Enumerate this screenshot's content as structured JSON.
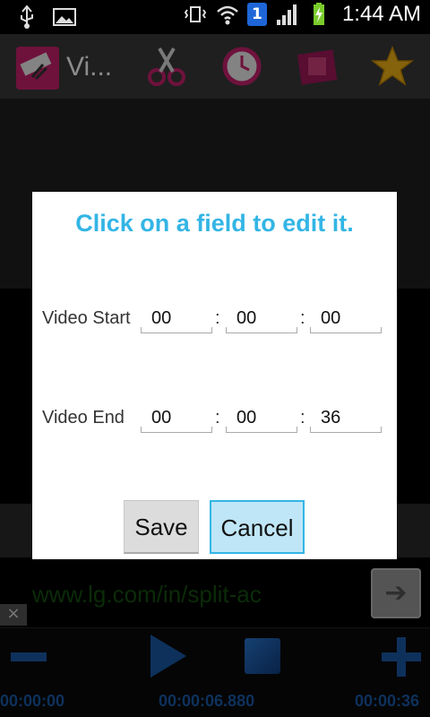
{
  "status_bar": {
    "time": "1:44 AM",
    "sim_badge": "1",
    "icons": [
      "usb-icon",
      "image-icon",
      "vibrate-icon",
      "wifi-icon",
      "sim-badge-icon",
      "signal-icon",
      "battery-charging-icon"
    ]
  },
  "action_bar": {
    "app_title": "Vi...",
    "icons": [
      "scissors-icon",
      "clock-icon",
      "film-icon",
      "star-icon"
    ]
  },
  "dialog": {
    "title": "Click on a field to edit it.",
    "start": {
      "label": "Video Start",
      "hh": "00",
      "mm": "00",
      "ss": "00"
    },
    "end": {
      "label": "Video End",
      "hh": "00",
      "mm": "00",
      "ss": "36"
    },
    "separator": ":",
    "save_label": "Save",
    "cancel_label": "Cancel"
  },
  "background": {
    "url_text": "www.lg.com/in/split-ac",
    "go_label": "➔",
    "close_label": "×",
    "time_start": "00:00:00",
    "time_current": "00:00:06.880",
    "time_end": "00:00:36"
  },
  "colors": {
    "accent": "#33b5e5",
    "player_blue": "#1a5aa8",
    "url_green": "#15500f"
  }
}
